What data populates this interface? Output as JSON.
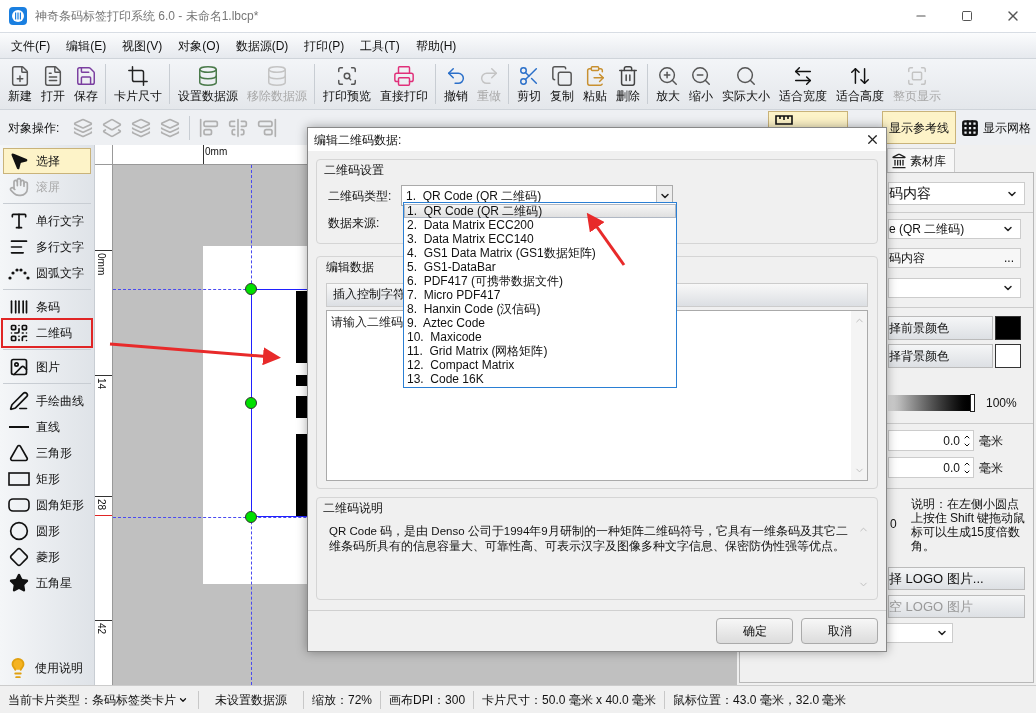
{
  "window": {
    "title": "神奇条码标签打印系统 6.0 - 未命名1.lbcp*"
  },
  "menu": [
    "文件(F)",
    "编辑(E)",
    "视图(V)",
    "对象(O)",
    "数据源(D)",
    "打印(P)",
    "工具(T)",
    "帮助(H)"
  ],
  "toolbar": [
    [
      {
        "label": "新建",
        "disabled": false
      },
      {
        "label": "打开",
        "disabled": false
      },
      {
        "label": "保存",
        "disabled": false
      }
    ],
    [
      {
        "label": "卡片尺寸",
        "disabled": false
      }
    ],
    [
      {
        "label": "设置数据源",
        "disabled": false
      },
      {
        "label": "移除数据源",
        "disabled": true
      }
    ],
    [
      {
        "label": "打印预览",
        "disabled": false
      },
      {
        "label": "直接打印",
        "disabled": false
      }
    ],
    [
      {
        "label": "撤销",
        "disabled": false
      },
      {
        "label": "重做",
        "disabled": true
      }
    ],
    [
      {
        "label": "剪切",
        "disabled": false
      },
      {
        "label": "复制",
        "disabled": false
      },
      {
        "label": "粘贴",
        "disabled": false
      },
      {
        "label": "删除",
        "disabled": false
      }
    ],
    [
      {
        "label": "放大",
        "disabled": false
      },
      {
        "label": "缩小",
        "disabled": false
      },
      {
        "label": "实际大小",
        "disabled": false
      },
      {
        "label": "适合宽度",
        "disabled": false
      },
      {
        "label": "适合高度",
        "disabled": false
      },
      {
        "label": "整页显示",
        "disabled": true
      }
    ]
  ],
  "object_bar": {
    "label": "对象操作:"
  },
  "view_toggles": [
    {
      "selected": true
    },
    {
      "label": "显示参考线",
      "selected": true
    },
    {
      "label": "显示网格",
      "selected": false
    }
  ],
  "tools": [
    [
      {
        "label": "选择",
        "selected": true,
        "disabled": false,
        "annotated": false
      },
      {
        "label": "滚屏",
        "selected": false,
        "disabled": true,
        "annotated": false
      }
    ],
    [
      {
        "label": "单行文字",
        "selected": false,
        "disabled": false,
        "annotated": false
      },
      {
        "label": "多行文字",
        "selected": false,
        "disabled": false,
        "annotated": false
      },
      {
        "label": "圆弧文字",
        "selected": false,
        "disabled": false,
        "annotated": false
      }
    ],
    [
      {
        "label": "条码",
        "selected": false,
        "disabled": false,
        "annotated": false
      },
      {
        "label": "二维码",
        "selected": false,
        "disabled": false,
        "annotated": true
      }
    ],
    [
      {
        "label": "图片",
        "selected": false,
        "disabled": false,
        "annotated": false
      }
    ],
    [
      {
        "label": "手绘曲线",
        "selected": false,
        "disabled": false,
        "annotated": false
      },
      {
        "label": "直线",
        "selected": false,
        "disabled": false,
        "annotated": false
      },
      {
        "label": "三角形",
        "selected": false,
        "disabled": false,
        "annotated": false
      },
      {
        "label": "矩形",
        "selected": false,
        "disabled": false,
        "annotated": false
      },
      {
        "label": "圆角矩形",
        "selected": false,
        "disabled": false,
        "annotated": false
      },
      {
        "label": "圆形",
        "selected": false,
        "disabled": false,
        "annotated": false
      },
      {
        "label": "菱形",
        "selected": false,
        "disabled": false,
        "annotated": false
      },
      {
        "label": "五角星",
        "selected": false,
        "disabled": false,
        "annotated": false
      }
    ]
  ],
  "help": {
    "label": "使用说明"
  },
  "rulers": {
    "horizontal": [
      "0mm"
    ],
    "vertical": [
      "0mm",
      "14",
      "28",
      "42"
    ]
  },
  "right_panel": {
    "tab": "素材库",
    "source_select": "码内容",
    "type_select": "e (QR 二维码)",
    "content_field": "码内容",
    "content_more": "...",
    "swatches": [
      {
        "label": "择前景颜色",
        "color": "#000000"
      },
      {
        "label": "择背景颜色",
        "color": "#ffffff"
      }
    ],
    "opacity": {
      "level": 1,
      "reading": "100%"
    },
    "offsets": [
      {
        "value": "0.0",
        "unit": "毫米"
      },
      {
        "value": "0.0",
        "unit": "毫米"
      }
    ],
    "cut_value": "0",
    "note": "说明：在左侧小圆点上按住 Shift 键拖动鼠标可以生成15度倍数角。",
    "logo_buttons": [
      {
        "label": "择 LOGO 图片...",
        "disabled": false
      },
      {
        "label": "空 LOGO 图片",
        "disabled": true
      }
    ]
  },
  "dialog": {
    "title": "编辑二维码数据:",
    "settings_group": "二维码设置",
    "type_label": "二维码类型:",
    "type_value": "1.  QR Code (QR 二维码)",
    "source_label": "数据来源:",
    "type_options": [
      {
        "label": "1.  QR Code (QR 二维码)",
        "selected": true
      },
      {
        "label": "2.  Data Matrix ECC200",
        "selected": false
      },
      {
        "label": "3.  Data Matrix ECC140",
        "selected": false
      },
      {
        "label": "4.  GS1 Data Matrix (GS1数据矩阵)",
        "selected": false
      },
      {
        "label": "5.  GS1-DataBar",
        "selected": false
      },
      {
        "label": "6.  PDF417 (可携带数据文件)",
        "selected": false
      },
      {
        "label": "7.  Micro PDF417",
        "selected": false
      },
      {
        "label": "8.  Hanxin Code (汉信码)",
        "selected": false
      },
      {
        "label": "9.  Aztec Code",
        "selected": false
      },
      {
        "label": "10.  Maxicode",
        "selected": false
      },
      {
        "label": "11.  Grid Matrix (网格矩阵)",
        "selected": false
      },
      {
        "label": "12.  Compact Matrix",
        "selected": false
      },
      {
        "label": "13.  Code 16K",
        "selected": false
      }
    ],
    "data_group": "编辑数据",
    "insert_button": "插入控制字符",
    "data_placeholder": "请输入二维码",
    "info_group": "二维码说明",
    "info_text": "QR Code 码，是由 Denso 公司于1994年9月研制的一种矩阵二维码符号，它具有一维条码及其它二维条码所具有的信息容量大、可靠性高、可表示汉字及图像多种文字信息、保密防伪性强等优点。",
    "buttons": [
      "确定",
      "取消"
    ]
  },
  "status": {
    "card_type": "当前卡片类型：条码标签类卡片",
    "items": [
      "未设置数据源",
      "缩放：72%",
      "画布DPI：300",
      "卡片尺寸：50.0 毫米 x 40.0 毫米",
      "鼠标位置：43.0 毫米，32.0 毫米"
    ]
  }
}
